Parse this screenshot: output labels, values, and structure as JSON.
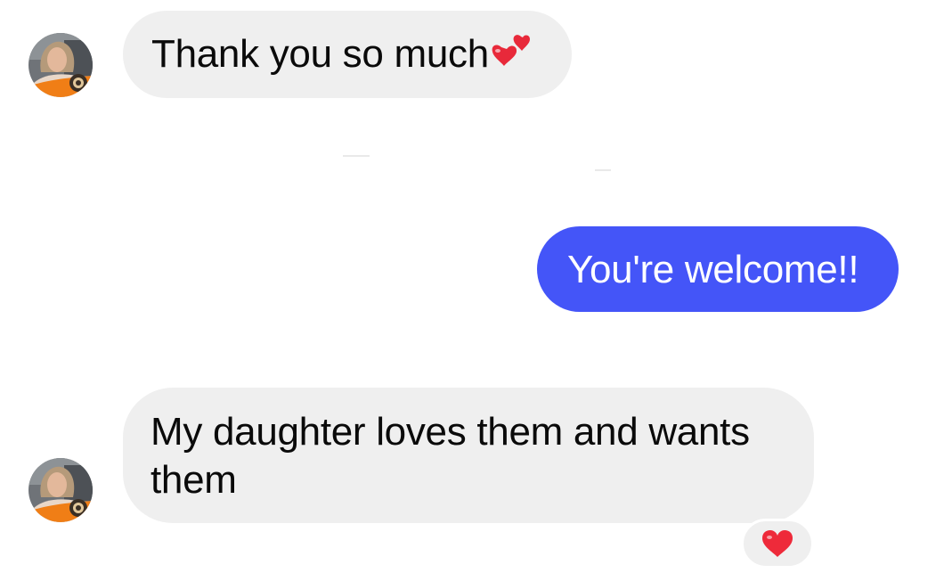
{
  "conversation": {
    "messages": [
      {
        "direction": "incoming",
        "text": "Thank you so much",
        "emoji": "two-hearts"
      },
      {
        "direction": "outgoing",
        "text": "You're welcome!!"
      },
      {
        "direction": "incoming",
        "text": "My daughter loves them and wants them",
        "reaction": "red-heart"
      }
    ]
  },
  "colors": {
    "incoming_bubble": "#efefef",
    "outgoing_bubble": "#4455f8",
    "incoming_text": "#0a0a0a",
    "outgoing_text": "#ffffff",
    "heart": "#ee2a3a"
  },
  "icons": {
    "avatar": "contact-avatar-photo",
    "inline_emoji": "two-hearts-icon",
    "reaction": "red-heart-icon"
  }
}
